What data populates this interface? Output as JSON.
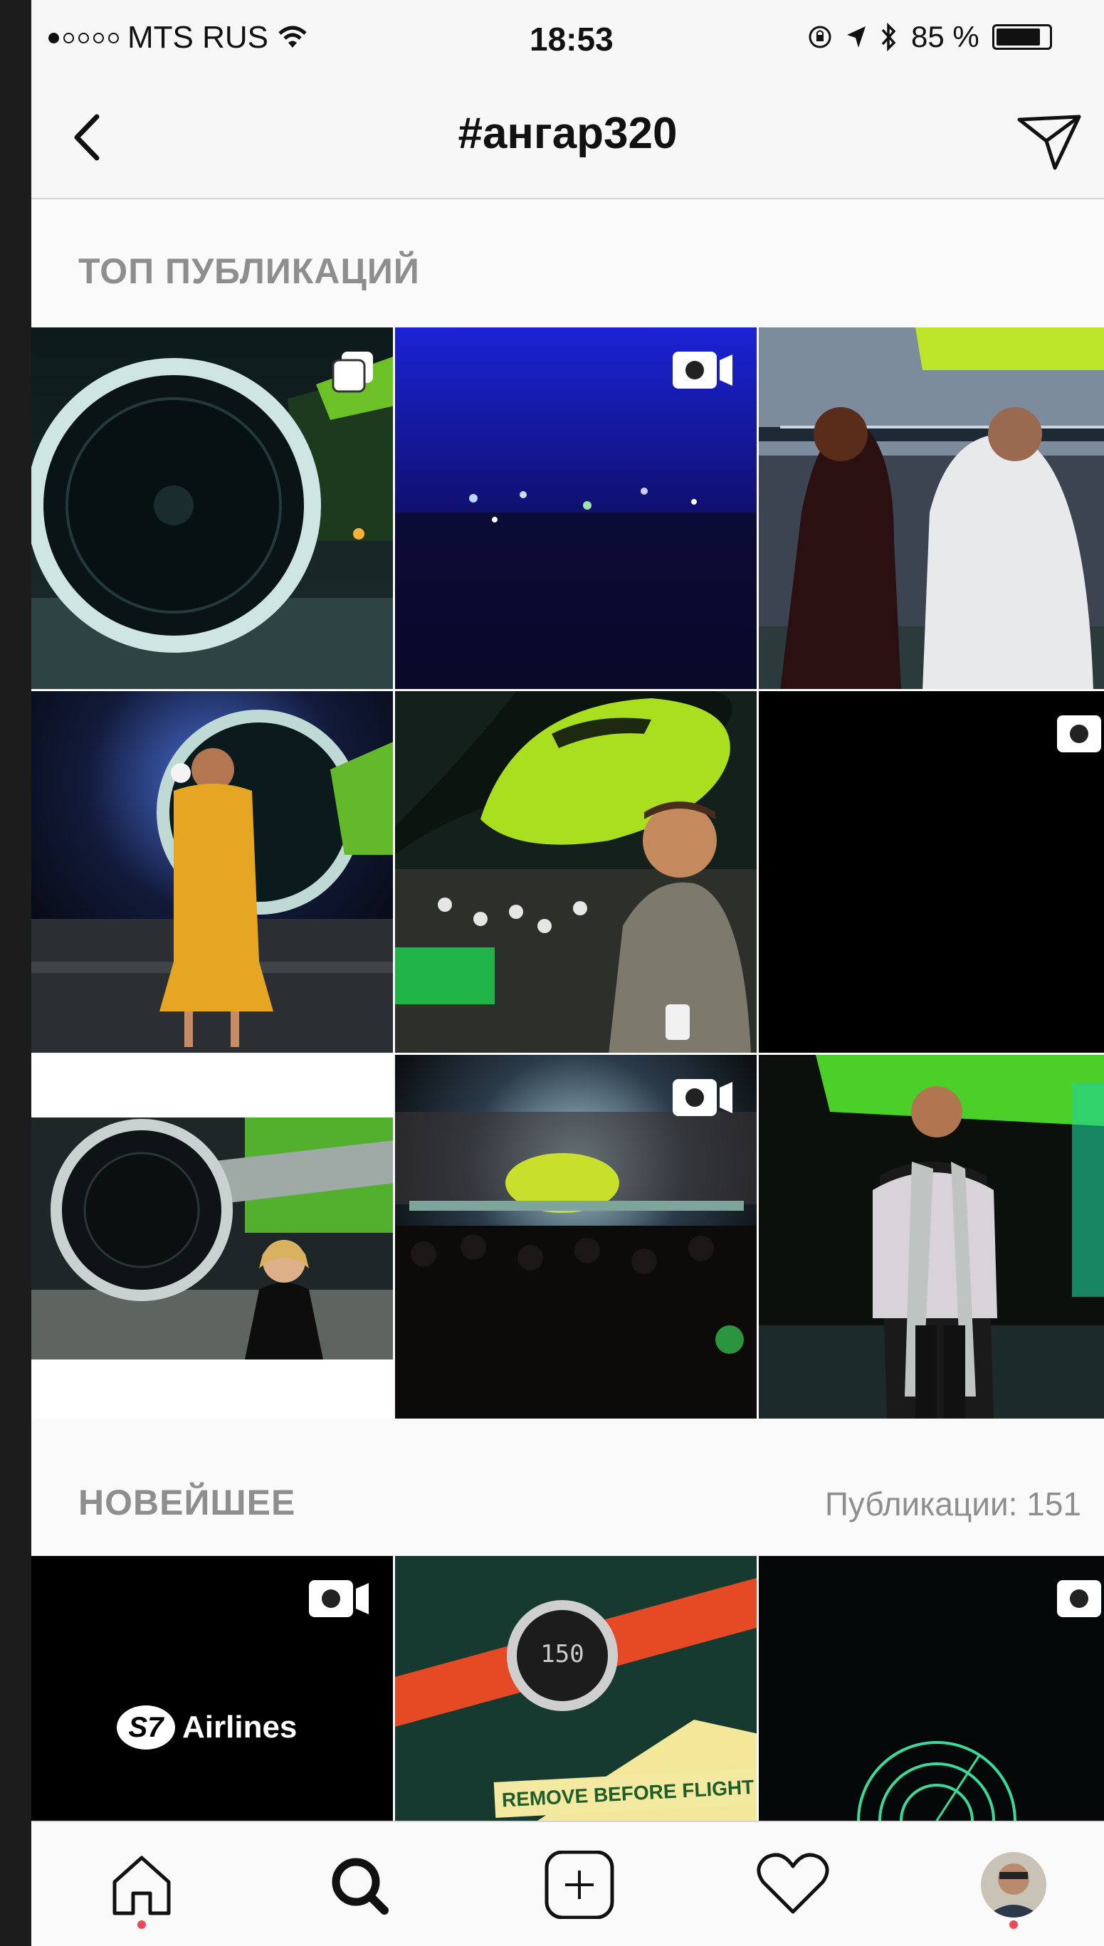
{
  "status_bar": {
    "carrier": "MTS RUS",
    "time": "18:53",
    "battery": "85 %",
    "battery_level": 0.85
  },
  "header": {
    "title": "#ангар320",
    "back_icon": "chevron-left-icon",
    "send_icon": "send-icon"
  },
  "sections": {
    "top": {
      "label": "ТОП ПУБЛИКАЦИЙ"
    },
    "recent": {
      "label": "НОВЕЙШЕЕ",
      "count": "Публикации: 151"
    }
  },
  "recent_tiles": {
    "s7_logo_text": "Airlines",
    "tag_text": "REMOVE BEFORE FLIGHT",
    "watch_text": "150"
  },
  "tabbar": {
    "items": [
      "home-icon",
      "search-icon",
      "add-post-icon",
      "heart-icon",
      "profile-avatar"
    ]
  },
  "colors": {
    "accent_green": "#9bd61e",
    "notification_dot": "#ed4956",
    "muted_text": "#8e8e8e"
  }
}
